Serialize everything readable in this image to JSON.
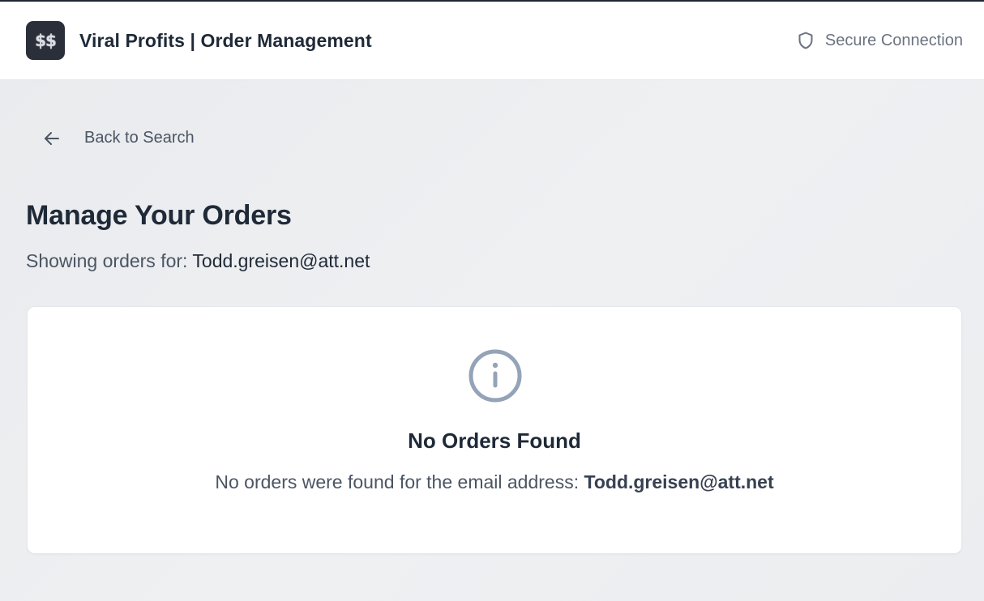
{
  "header": {
    "logo_text": "$$",
    "title": "Viral Profits | Order Management",
    "secure_label": "Secure Connection"
  },
  "nav": {
    "back_label": "Back to Search"
  },
  "page": {
    "title": "Manage Your Orders",
    "showing_prefix": "Showing orders for:",
    "email": "Todd.greisen@att.net"
  },
  "empty_state": {
    "title": "No Orders Found",
    "message_prefix": "No orders were found for the email address:",
    "email": "Todd.greisen@att.net"
  },
  "icons": {
    "logo": "dollar-logo-icon",
    "secure": "shield-icon",
    "back": "arrow-left-icon",
    "info": "info-circle-icon"
  },
  "colors": {
    "header_bg": "#ffffff",
    "page_bg": "#eceef1",
    "logo_bg": "#2a2f3a",
    "text_primary": "#1f2937",
    "text_secondary": "#4b5563",
    "icon_muted": "#94a3b8"
  }
}
